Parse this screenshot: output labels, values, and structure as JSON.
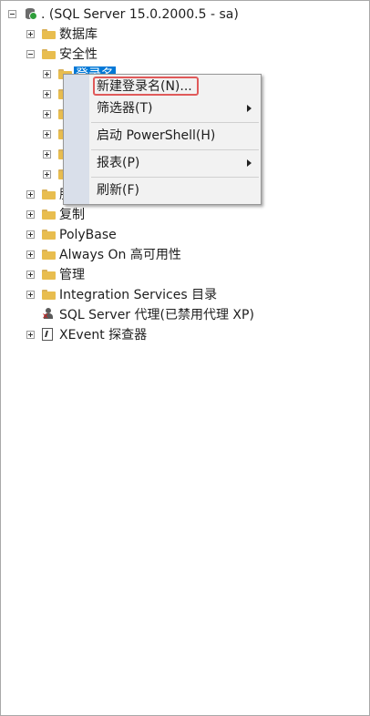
{
  "tree": {
    "root": {
      "label": ". (SQL Server 15.0.2000.5 - sa)"
    },
    "items": [
      {
        "label": "数据库"
      },
      {
        "label": "安全性"
      },
      {
        "label": "登录名"
      },
      {
        "label": ""
      },
      {
        "label": ""
      },
      {
        "label": ""
      },
      {
        "label": ""
      },
      {
        "label": "服"
      },
      {
        "label": "复制"
      },
      {
        "label": "PolyBase"
      },
      {
        "label": "Always On 高可用性"
      },
      {
        "label": "管理"
      },
      {
        "label": "Integration Services 目录"
      },
      {
        "label": "SQL Server 代理(已禁用代理 XP)"
      },
      {
        "label": "XEvent 探查器"
      }
    ]
  },
  "context_menu": {
    "items": [
      {
        "label": "新建登录名(N)...",
        "has_submenu": false
      },
      {
        "label": "筛选器(T)",
        "has_submenu": true
      },
      {
        "label": "启动 PowerShell(H)",
        "has_submenu": false
      },
      {
        "label": "报表(P)",
        "has_submenu": true
      },
      {
        "label": "刷新(F)",
        "has_submenu": false
      }
    ]
  },
  "colors": {
    "selection": "#0078d7",
    "folder": "#e8bd4f",
    "highlight_outline": "#e05a5a"
  }
}
